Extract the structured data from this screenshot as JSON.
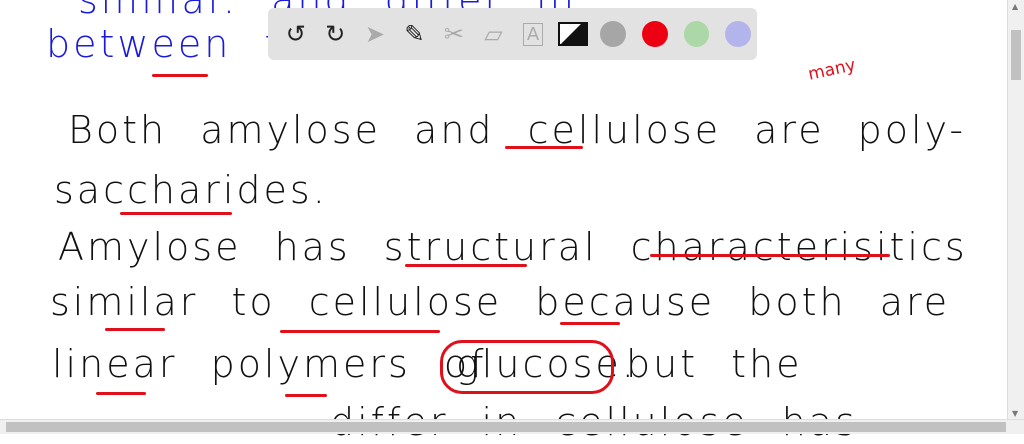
{
  "notes": {
    "top_line_blue": "similar. and differ in",
    "line_between": "between th",
    "annotation_many": "many",
    "line1": "Both amylose and cellulose are poly-",
    "line2": "saccharides.",
    "line3": "Amylose has structural characterisitics",
    "line4": "similar to cellulose because both are",
    "line5_a": "linear polymers of",
    "line5_circled": "glucose.",
    "line5_b": "but the",
    "line6": "differ   in   cellulose  has"
  },
  "toolbar": {
    "tools": [
      "undo-icon",
      "redo-icon",
      "pointer-icon",
      "pen-icon",
      "scissors-icon",
      "eraser-icon",
      "text-icon",
      "image-icon"
    ],
    "colors": [
      "#a6a6a6",
      "#ec0012",
      "#acd8a7",
      "#b4b4ec"
    ]
  }
}
